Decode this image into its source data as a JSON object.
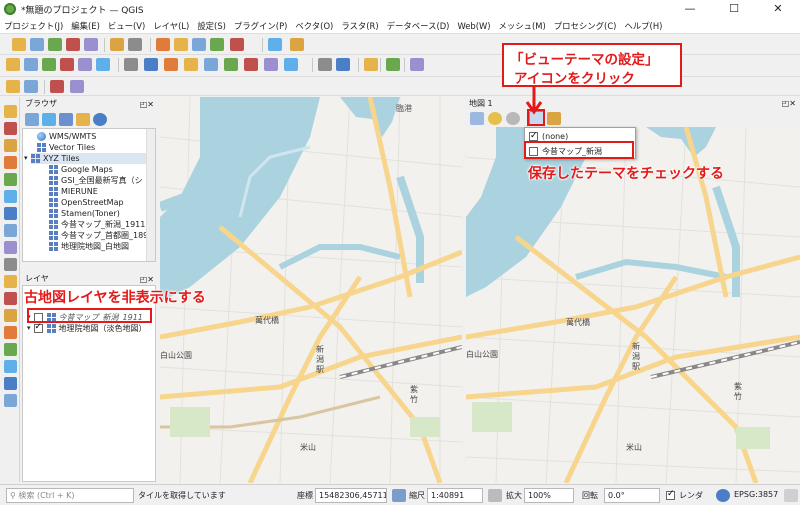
{
  "app": {
    "title": "*無題のプロジェクト — QGIS"
  },
  "menu": [
    "プロジェクト(J)",
    "編集(E)",
    "ビュー(V)",
    "レイヤ(L)",
    "設定(S)",
    "プラグイン(P)",
    "ベクタ(O)",
    "ラスタ(R)",
    "データベース(D)",
    "Web(W)",
    "メッシュ(M)",
    "プロセシング(C)",
    "ヘルプ(H)"
  ],
  "browser": {
    "title": "ブラウザ",
    "items": [
      {
        "label": "WMS/WMTS",
        "icon": "globe"
      },
      {
        "label": "Vector Tiles",
        "icon": "grid"
      },
      {
        "label": "XYZ Tiles",
        "icon": "grid"
      },
      {
        "label": "Google Maps",
        "icon": "grid"
      },
      {
        "label": "GSI_全国最新写真（シ",
        "icon": "grid"
      },
      {
        "label": "MIERUNE",
        "icon": "grid"
      },
      {
        "label": "OpenStreetMap",
        "icon": "grid"
      },
      {
        "label": "Stamen(Toner)",
        "icon": "grid"
      },
      {
        "label": "今昔マップ_新潟_1911",
        "icon": "grid"
      },
      {
        "label": "今昔マップ_首都圏_1896",
        "icon": "grid"
      },
      {
        "label": "地理院地図_白地図",
        "icon": "grid"
      }
    ]
  },
  "layers": {
    "title": "レイヤ",
    "items": [
      {
        "label": "今昔マップ_新潟_1911",
        "checked": false
      },
      {
        "label": "地理院地図（淡色地図）",
        "checked": true
      }
    ]
  },
  "map2": {
    "title": "地図 1",
    "themes": [
      {
        "label": "(none)",
        "checked": true
      },
      {
        "label": "今昔マップ_新潟",
        "checked": false
      }
    ]
  },
  "map_labels": {
    "bandaibashi": "萬代橋",
    "niigata_st": "新潟駅",
    "hakusan": "白山公園",
    "yoneyama": "米山",
    "shinkou": "臨港",
    "shichiku": "紫竹",
    "kouen": "公園"
  },
  "annotations": {
    "theme_button_1": "「ビューテーマの設定」",
    "theme_button_2": "アイコンをクリック",
    "check_theme": "保存したテーマをチェックする",
    "hide_layer": "古地図レイヤを非表示にする"
  },
  "status": {
    "search_placeholder": "検索 (Ctrl + K)",
    "message": "タイルを取得しています",
    "coord_label": "座標",
    "coord_value": "15482306,4571152",
    "scale_label": "縮尺",
    "scale_value": "1:40891",
    "magnifier_label": "拡大",
    "magnifier_value": "100%",
    "rotation_label": "回転",
    "rotation_value": "0.0°",
    "render_label": "レンダ",
    "crs": "EPSG:3857"
  },
  "colors": {
    "accent": "#e31a1a",
    "water": "#aad3df",
    "road": "#f7d58c",
    "bg": "#f2f1ee"
  }
}
